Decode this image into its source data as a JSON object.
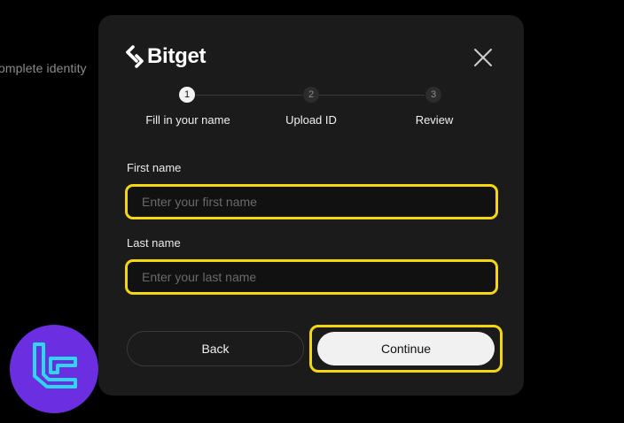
{
  "background": {
    "partial_text": "omplete identity"
  },
  "modal": {
    "brand": "Bitget",
    "close_icon": "close-icon",
    "steps": [
      {
        "number": "1",
        "label": "Fill in your name",
        "active": true
      },
      {
        "number": "2",
        "label": "Upload ID",
        "active": false
      },
      {
        "number": "3",
        "label": "Review",
        "active": false
      }
    ],
    "first_name": {
      "label": "First name",
      "placeholder": "Enter your first name",
      "value": ""
    },
    "last_name": {
      "label": "Last name",
      "placeholder": "Enter your last name",
      "value": ""
    },
    "back_label": "Back",
    "continue_label": "Continue"
  },
  "colors": {
    "highlight": "#f5d70f",
    "modal_bg": "#1b1b1b",
    "watermark_bg": "#6b2ee0",
    "watermark_fg": "#2bd8f0"
  },
  "watermark_icon": "tc-logo-icon"
}
